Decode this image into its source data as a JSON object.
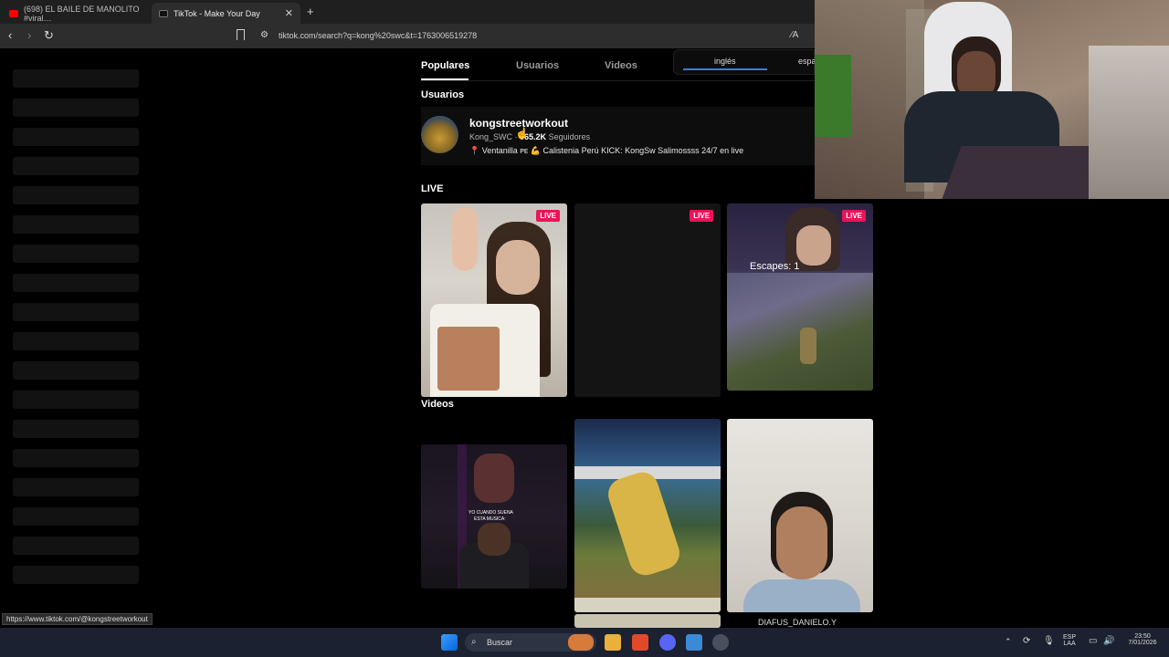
{
  "browser": {
    "tabs": [
      {
        "label": "(698) EL BAILE DE MANOLITO #viral…",
        "favicon_color": "#ff0000"
      },
      {
        "label": "TikTok - Make Your Day",
        "favicon_color": "#111111"
      }
    ],
    "new_tab": "+",
    "url": "tiktok.com/search?q=kong%20swc&t=1763006519278",
    "status_url": "https://www.tiktok.com/@kongstreetworkout"
  },
  "search_tabs": [
    "Populares",
    "Usuarios",
    "Videos"
  ],
  "translate": {
    "option1": "inglés",
    "option2": "espa"
  },
  "users_section": {
    "title": "Usuarios",
    "user": {
      "name": "kongstreetworkout",
      "handle": "Kong_SWC",
      "followers": "365.2K",
      "followers_label": "Seguidores",
      "bio": "📍 Ventanilla ᴘᴇ 💪 Calistenia Perú KICK: KongSw Salimossss 24/7 en live"
    }
  },
  "live_section": {
    "title": "LIVE",
    "badge": "LIVE",
    "overlay": "Escapes: 1"
  },
  "videos_section": {
    "title": "Videos",
    "caption3": "DIAFUS_DANIELO.Y",
    "overlay1_line1": "YO CUANDO SUENA",
    "overlay1_line2": "ESTA MUSICA:"
  },
  "taskbar": {
    "search_placeholder": "Buscar",
    "lang_top": "ESP",
    "lang_bottom": "LAA",
    "time": "23:50",
    "date": "7/01/2026"
  },
  "colors": {
    "live_badge": "#ea1459",
    "accent": "#3d7bd6"
  }
}
